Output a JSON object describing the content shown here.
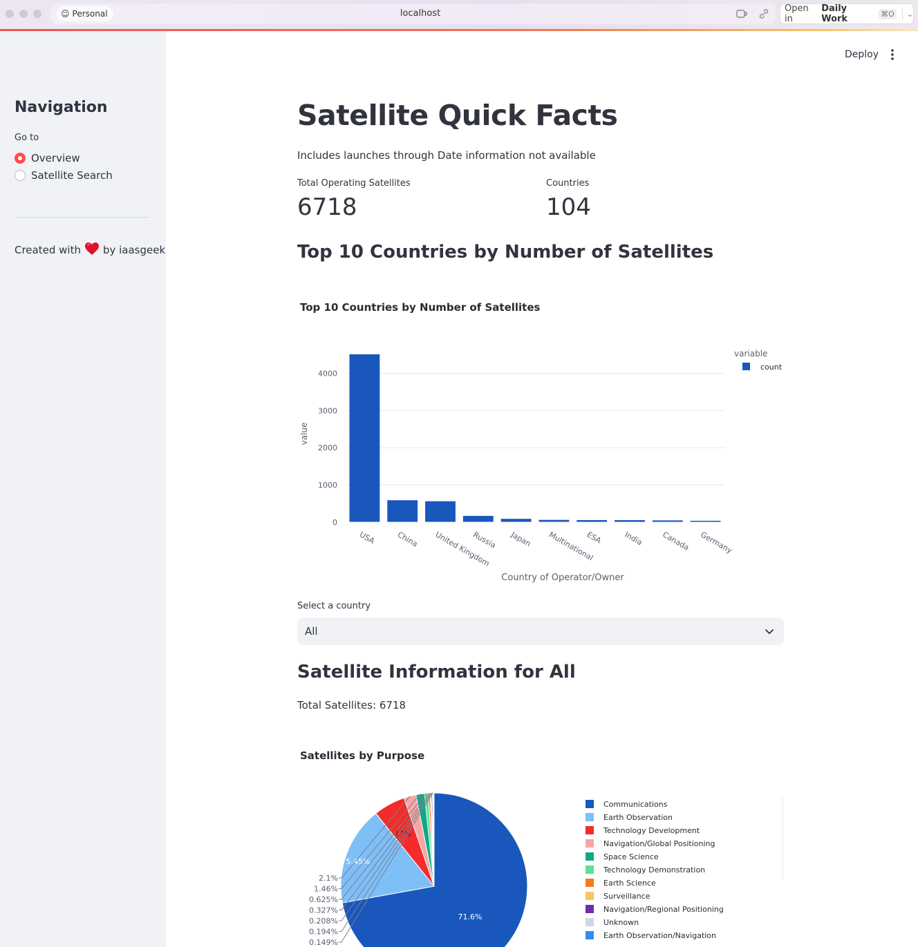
{
  "browser": {
    "profile": "Personal",
    "url": "localhost",
    "open_in_prefix": "Open in",
    "open_in_target": "Daily Work",
    "open_in_shortcut": "⌘O"
  },
  "sidebar": {
    "title": "Navigation",
    "goto_label": "Go to",
    "options": [
      {
        "label": "Overview",
        "selected": true
      },
      {
        "label": "Satellite Search",
        "selected": false
      }
    ],
    "created_prefix": "Created with",
    "created_suffix": "by iaasgeek",
    "heart_color": "#e0112b"
  },
  "header": {
    "deploy_label": "Deploy",
    "menu_icon": "vertical-dots-icon"
  },
  "main": {
    "title": "Satellite Quick Facts",
    "caption": "Includes launches through Date information not available",
    "metrics": [
      {
        "label": "Total Operating Satellites",
        "value": "6718"
      },
      {
        "label": "Countries",
        "value": "104"
      }
    ],
    "section1_heading": "Top 10 Countries by Number of Satellites",
    "select_label": "Select a country",
    "select_value": "All",
    "section2_heading": "Satellite Information for All",
    "total_satellites_text": "Total Satellites: 6718"
  },
  "accent_color": "#ff4b4b",
  "chart_data": [
    {
      "type": "bar",
      "title": "Top 10 Countries by Number of Satellites",
      "xlabel": "Country of Operator/Owner",
      "ylabel": "value",
      "categories": [
        "USA",
        "China",
        "United Kingdom",
        "Russia",
        "Japan",
        "Multinational",
        "ESA",
        "India",
        "Canada",
        "Germany"
      ],
      "series": [
        {
          "name": "count",
          "values": [
            4511,
            590,
            563,
            170,
            90,
            62,
            57,
            55,
            49,
            38
          ],
          "color": "#1957bd"
        }
      ],
      "legend_title": "variable",
      "legend_position": "top-right",
      "yticks": [
        0,
        1000,
        2000,
        3000,
        4000
      ],
      "ylim": [
        0,
        4750
      ],
      "grid": true
    },
    {
      "type": "pie",
      "title": "Satellites by Purpose",
      "legend_position": "right",
      "labels": [
        "Communications",
        "Earth Observation",
        "Technology Development",
        "Navigation/Global Positioning",
        "Space Science",
        "Technology Demonstration",
        "Earth Science",
        "Surveillance",
        "Navigation/Regional Positioning",
        "Unknown",
        "Earth Observation/Navigation"
      ],
      "values": [
        71.6,
        17,
        5.45,
        2.1,
        1.46,
        0.625,
        0.327,
        0.208,
        0.194,
        0.149,
        0.134
      ],
      "value_labels": [
        "71.6%",
        "17%",
        "5.45%",
        "2.1%",
        "1.46%",
        "0.625%",
        "0.327%",
        "0.208%",
        "0.194%",
        "0.149%"
      ],
      "inside_labels": [
        "71.6%",
        "17%",
        "5.45%"
      ],
      "colors": [
        "#1957bd",
        "#7fbff8",
        "#f52a2a",
        "#f7a6a6",
        "#11a888",
        "#5ee09c",
        "#f7791f",
        "#fcc266",
        "#6f2db2",
        "#d2d6de",
        "#2f8cf0"
      ]
    }
  ]
}
